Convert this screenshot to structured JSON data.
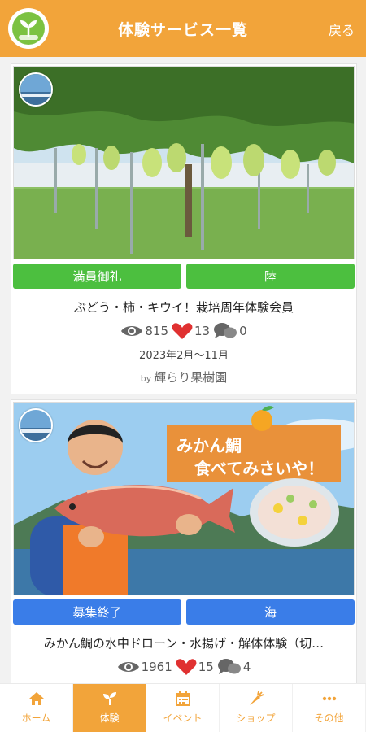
{
  "header": {
    "title": "体験サービス一覧",
    "back_label": "戻る"
  },
  "colors": {
    "brand": "#f2a43a",
    "green_tag": "#4cbf3f",
    "blue_tag": "#3a7de8",
    "heart": "#e03131"
  },
  "cards": [
    {
      "tags": [
        {
          "label": "満員御礼",
          "color": "green"
        },
        {
          "label": "陸",
          "color": "green"
        }
      ],
      "title": "ぶどう・柿・キウイ！栽培周年体験会員",
      "views": "815",
      "likes": "13",
      "comments": "0",
      "date": "2023年2月～11月",
      "by": "by",
      "provider": "輝らり果樹園"
    },
    {
      "image_text_line1": "みかん鯛",
      "image_text_line2": "食べてみさいや！",
      "tags": [
        {
          "label": "募集終了",
          "color": "blue"
        },
        {
          "label": "海",
          "color": "blue"
        }
      ],
      "title": "みかん鯛の水中ドローン・水揚げ・解体体験（切…",
      "views": "1961",
      "likes": "15",
      "comments": "4"
    }
  ],
  "nav": [
    {
      "label": "ホーム",
      "icon": "home-icon",
      "active": false
    },
    {
      "label": "体験",
      "icon": "sprout-icon",
      "active": true
    },
    {
      "label": "イベント",
      "icon": "calendar-icon",
      "active": false
    },
    {
      "label": "ショップ",
      "icon": "carrot-icon",
      "active": false
    },
    {
      "label": "その他",
      "icon": "more-icon",
      "active": false
    }
  ]
}
